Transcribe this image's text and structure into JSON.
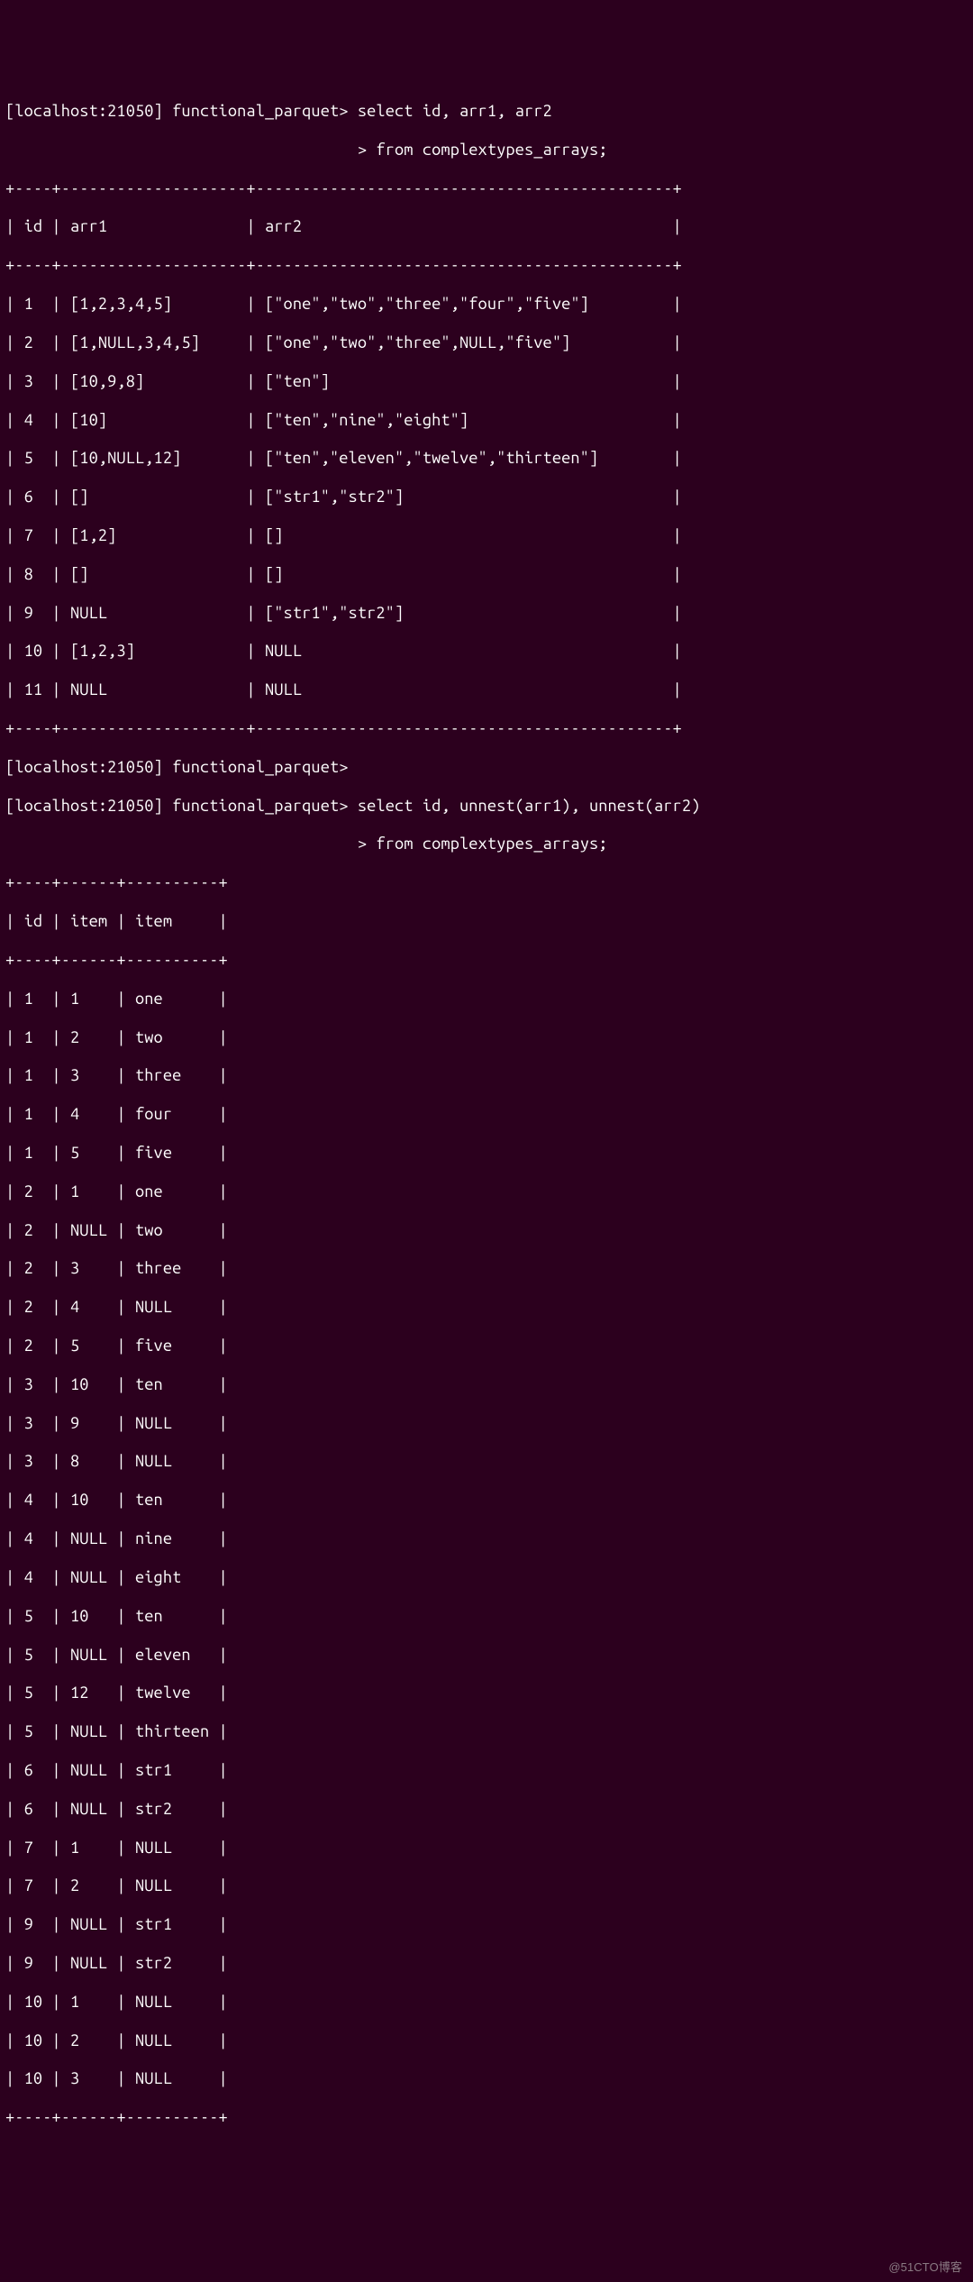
{
  "prompt1": {
    "host": "[localhost:21050] functional_parquet>",
    "cont": "                                      >",
    "query_l1": "select id, arr1, arr2",
    "query_l2": "from complextypes_arrays;"
  },
  "table1": {
    "border_top": "+----+--------------------+---------------------------------------------+",
    "header": "| id | arr1               | arr2                                        |",
    "border_mid": "+----+--------------------+---------------------------------------------+",
    "rows": [
      "| 1  | [1,2,3,4,5]        | [\"one\",\"two\",\"three\",\"four\",\"five\"]         |",
      "| 2  | [1,NULL,3,4,5]     | [\"one\",\"two\",\"three\",NULL,\"five\"]           |",
      "| 3  | [10,9,8]           | [\"ten\"]                                     |",
      "| 4  | [10]               | [\"ten\",\"nine\",\"eight\"]                      |",
      "| 5  | [10,NULL,12]       | [\"ten\",\"eleven\",\"twelve\",\"thirteen\"]        |",
      "| 6  | []                 | [\"str1\",\"str2\"]                             |",
      "| 7  | [1,2]              | []                                          |",
      "| 8  | []                 | []                                          |",
      "| 9  | NULL               | [\"str1\",\"str2\"]                             |",
      "| 10 | [1,2,3]            | NULL                                        |",
      "| 11 | NULL               | NULL                                        |"
    ],
    "border_bot": "+----+--------------------+---------------------------------------------+"
  },
  "prompt2": {
    "blank": "[localhost:21050] functional_parquet>",
    "host": "[localhost:21050] functional_parquet>",
    "cont": "                                      >",
    "query_l1": "select id, unnest(arr1), unnest(arr2)",
    "query_l2": "from complextypes_arrays;"
  },
  "table2": {
    "border_top": "+----+------+----------+",
    "header": "| id | item | item     |",
    "border_mid": "+----+------+----------+",
    "rows": [
      "| 1  | 1    | one      |",
      "| 1  | 2    | two      |",
      "| 1  | 3    | three    |",
      "| 1  | 4    | four     |",
      "| 1  | 5    | five     |",
      "| 2  | 1    | one      |",
      "| 2  | NULL | two      |",
      "| 2  | 3    | three    |",
      "| 2  | 4    | NULL     |",
      "| 2  | 5    | five     |",
      "| 3  | 10   | ten      |",
      "| 3  | 9    | NULL     |",
      "| 3  | 8    | NULL     |",
      "| 4  | 10   | ten      |",
      "| 4  | NULL | nine     |",
      "| 4  | NULL | eight    |",
      "| 5  | 10   | ten      |",
      "| 5  | NULL | eleven   |",
      "| 5  | 12   | twelve   |",
      "| 5  | NULL | thirteen |",
      "| 6  | NULL | str1     |",
      "| 6  | NULL | str2     |",
      "| 7  | 1    | NULL     |",
      "| 7  | 2    | NULL     |",
      "| 9  | NULL | str1     |",
      "| 9  | NULL | str2     |",
      "| 10 | 1    | NULL     |",
      "| 10 | 2    | NULL     |",
      "| 10 | 3    | NULL     |"
    ],
    "border_bot": "+----+------+----------+"
  },
  "watermark": "@51CTO博客"
}
